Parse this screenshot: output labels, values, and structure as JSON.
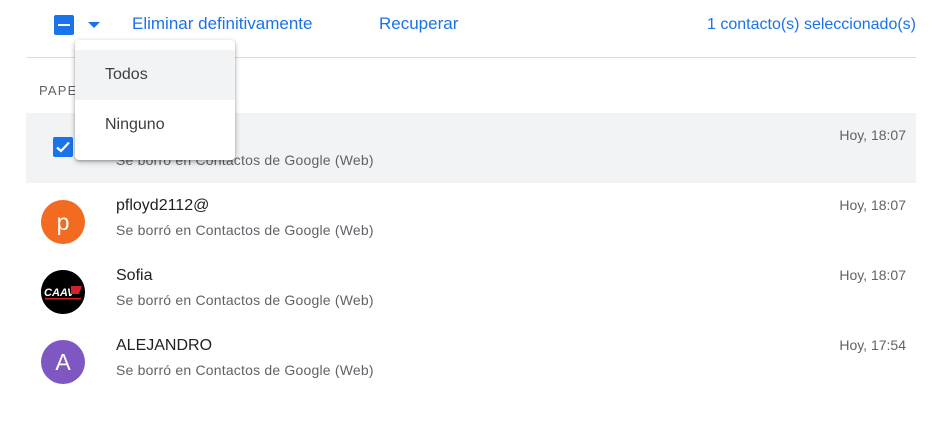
{
  "toolbar": {
    "delete_label": "Eliminar definitivamente",
    "recover_label": "Recuperar",
    "selected_count": "1 contacto(s) seleccionado(s)"
  },
  "section_label": "PAPE",
  "dropdown": {
    "items": [
      {
        "label": "Todos"
      },
      {
        "label": "Ninguno"
      }
    ]
  },
  "rows": [
    {
      "name": "",
      "subtitle": "Se borró en Contactos de Google (Web)",
      "time": "Hoy, 18:07",
      "selected": true
    },
    {
      "name": "pfloyd2112@",
      "subtitle": "Se borró en Contactos de Google (Web)",
      "time": "Hoy, 18:07",
      "avatar_letter": "p",
      "avatar_color": "#f26b21"
    },
    {
      "name": "Sofia",
      "subtitle": "Se borró en Contactos de Google (Web)",
      "time": "Hoy, 18:07",
      "avatar_logo_text": "CAAV"
    },
    {
      "name": "ALEJANDRO",
      "subtitle": "Se borró en Contactos de Google (Web)",
      "time": "Hoy, 17:54",
      "avatar_letter": "A",
      "avatar_color": "#7e57c2"
    }
  ],
  "colors": {
    "accent": "#1a73e8",
    "selected_row": "#f1f3f4"
  }
}
